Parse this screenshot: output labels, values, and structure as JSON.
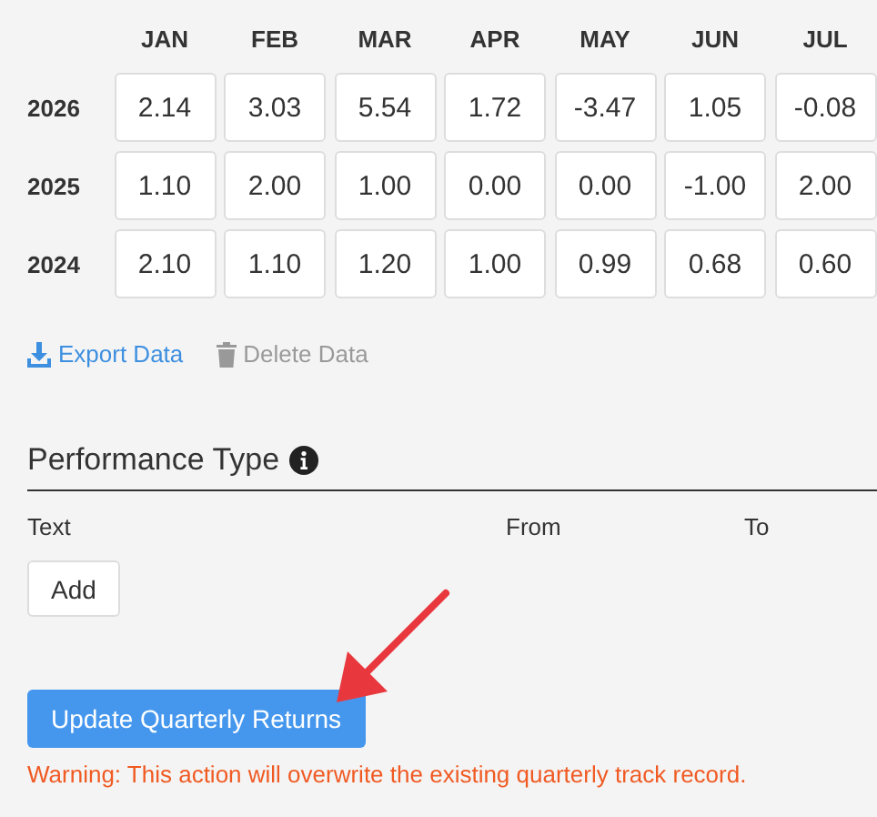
{
  "returns_table": {
    "columns": [
      "JAN",
      "FEB",
      "MAR",
      "APR",
      "MAY",
      "JUN",
      "JUL"
    ],
    "rows": [
      {
        "year": "2026",
        "values": [
          "2.14",
          "3.03",
          "5.54",
          "1.72",
          "-3.47",
          "1.05",
          "-0.08"
        ]
      },
      {
        "year": "2025",
        "values": [
          "1.10",
          "2.00",
          "1.00",
          "0.00",
          "0.00",
          "-1.00",
          "2.00"
        ]
      },
      {
        "year": "2024",
        "values": [
          "2.10",
          "1.10",
          "1.20",
          "1.00",
          "0.99",
          "0.68",
          "0.60"
        ]
      }
    ]
  },
  "data_actions": [
    {
      "kind": "export",
      "label": "Export Data",
      "disabled": false
    },
    {
      "kind": "delete",
      "label": "Delete Data",
      "disabled": true
    }
  ],
  "performance_type": {
    "title": "Performance Type",
    "columns": [
      "Text",
      "From",
      "To"
    ],
    "add_button": "Add"
  },
  "update_button": "Update Quarterly Returns",
  "warning": "Warning: This action will overwrite the existing quarterly track record."
}
